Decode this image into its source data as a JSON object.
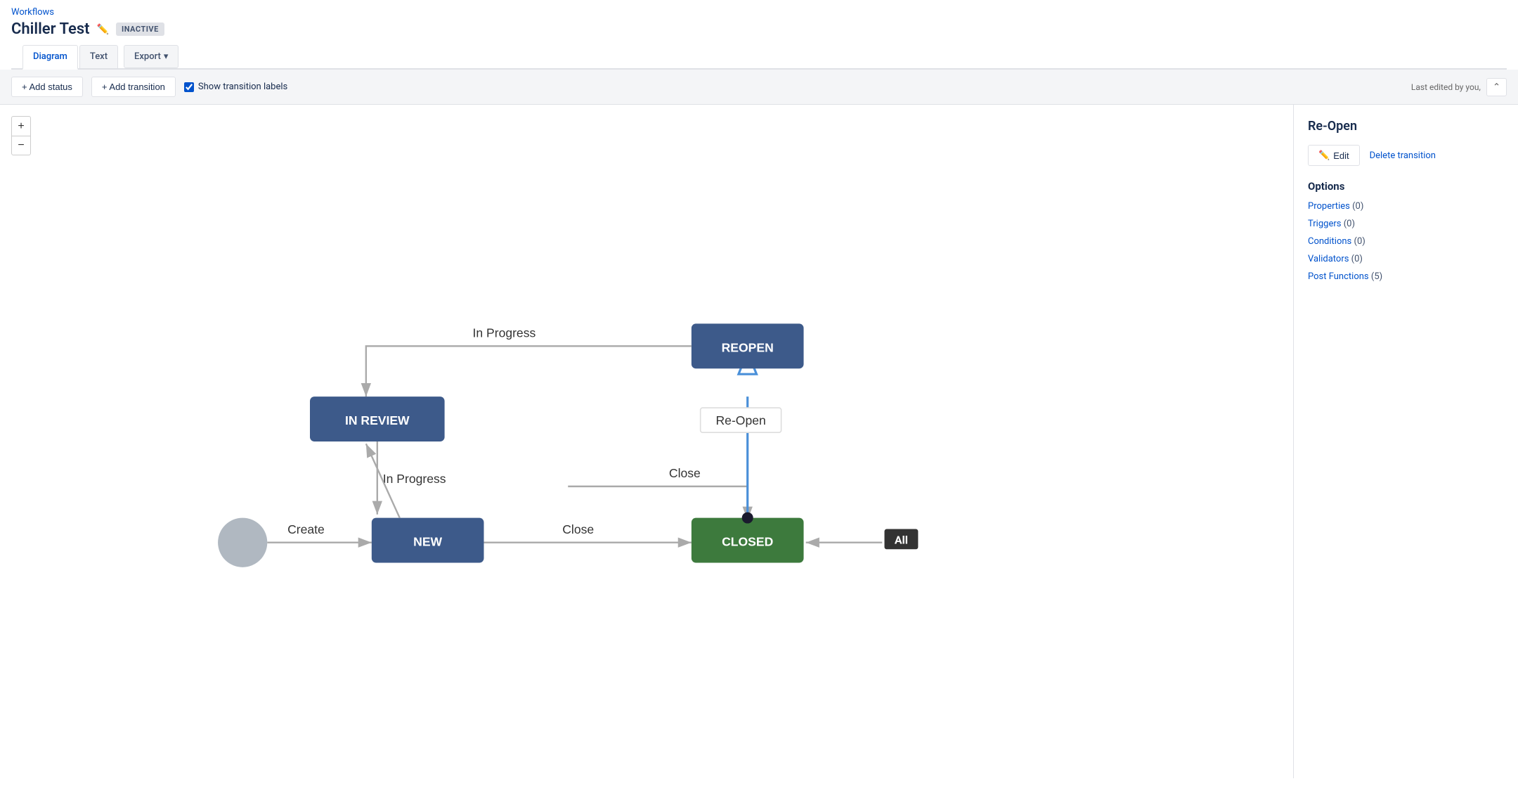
{
  "breadcrumb": "Workflows",
  "title": "Chiller Test",
  "badge": "INACTIVE",
  "tabs": [
    {
      "label": "Diagram",
      "active": true
    },
    {
      "label": "Text",
      "active": false
    }
  ],
  "export_label": "Export",
  "toolbar": {
    "add_status_label": "+ Add status",
    "add_transition_label": "+ Add transition",
    "show_transition_labels": "Show transition labels",
    "last_edited": "Last edited by you,"
  },
  "zoom": {
    "plus": "+",
    "minus": "−"
  },
  "side_panel": {
    "title": "Re-Open",
    "edit_label": "Edit",
    "delete_label": "Delete transition",
    "options_title": "Options",
    "options": [
      {
        "label": "Properties",
        "count": "(0)"
      },
      {
        "label": "Triggers",
        "count": "(0)"
      },
      {
        "label": "Conditions",
        "count": "(0)"
      },
      {
        "label": "Validators",
        "count": "(0)"
      },
      {
        "label": "Post Functions",
        "count": "(5)"
      }
    ]
  },
  "nodes": {
    "reopen": "REOPEN",
    "in_review": "IN REVIEW",
    "new": "NEW",
    "closed": "CLOSED"
  },
  "transition_labels": {
    "in_progress_1": "In Progress",
    "in_progress_2": "In Progress",
    "reopen": "Re-Open",
    "create": "Create",
    "close_1": "Close",
    "close_2": "Close",
    "all": "All"
  }
}
